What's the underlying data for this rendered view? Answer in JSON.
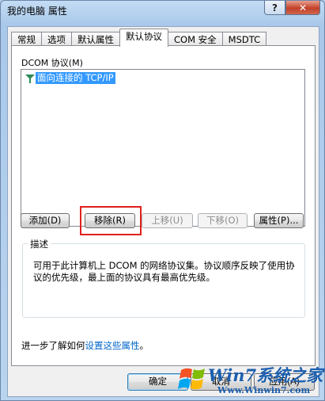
{
  "window": {
    "title": "我的电脑 属性",
    "help_glyph": "?",
    "close_glyph": "✕"
  },
  "tabs": [
    {
      "label": "常规",
      "active": false
    },
    {
      "label": "选项",
      "active": false
    },
    {
      "label": "默认属性",
      "active": false
    },
    {
      "label": "默认协议",
      "active": true
    },
    {
      "label": "COM 安全",
      "active": false
    },
    {
      "label": "MSDTC",
      "active": false
    }
  ],
  "protocols": {
    "label": "DCOM 协议(M)",
    "items": [
      {
        "label": "面向连接的 TCP/IP",
        "selected": true
      }
    ]
  },
  "actions": {
    "add": "添加(D)",
    "remove": "移除(R)",
    "move_up": "上移(U)",
    "move_down": "下移(O)",
    "properties": "属性(P)..."
  },
  "description": {
    "title": "描述",
    "text": "可用于此计算机上 DCOM 的网络协议集。协议顺序反映了使用协议的优先级，最上面的协议具有最高优先级。"
  },
  "learn_more": {
    "prefix": "进一步了解如何",
    "link": "设置这些属性",
    "suffix": "。"
  },
  "footer": {
    "ok": "确定",
    "cancel": "取消",
    "apply": "应用(A)"
  },
  "watermark": {
    "brand": "Win7系统之家",
    "url": "Www.Winwin7.com"
  },
  "colors": {
    "selection": "#3399ff",
    "highlight_box": "#e0201c",
    "link": "#0066cc"
  }
}
